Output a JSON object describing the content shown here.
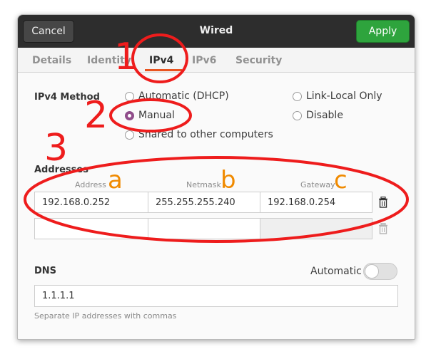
{
  "window": {
    "title": "Wired",
    "cancel_label": "Cancel",
    "apply_label": "Apply"
  },
  "tabs": [
    {
      "label": "Details",
      "active": false
    },
    {
      "label": "Identity",
      "active": false
    },
    {
      "label": "IPv4",
      "active": true
    },
    {
      "label": "IPv6",
      "active": false
    },
    {
      "label": "Security",
      "active": false
    }
  ],
  "ipv4": {
    "method_label": "IPv4 Method",
    "methods": [
      {
        "label": "Automatic (DHCP)",
        "selected": false
      },
      {
        "label": "Manual",
        "selected": true
      },
      {
        "label": "Shared to other computers",
        "selected": false
      },
      {
        "label": "Link-Local Only",
        "selected": false
      },
      {
        "label": "Disable",
        "selected": false
      }
    ],
    "addresses_label": "Addresses",
    "columns": {
      "address": "Address",
      "netmask": "Netmask",
      "gateway": "Gateway"
    },
    "rows": [
      {
        "address": "192.168.0.252",
        "netmask": "255.255.255.240",
        "gateway": "192.168.0.254"
      },
      {
        "address": "",
        "netmask": "",
        "gateway": ""
      }
    ]
  },
  "dns": {
    "label": "DNS",
    "automatic_label": "Automatic",
    "automatic_on": false,
    "value": "1.1.1.1",
    "hint": "Separate IP addresses with commas"
  },
  "annotations": {
    "numbers": [
      "1",
      "2",
      "3"
    ],
    "letters": [
      "a",
      "b",
      "c"
    ]
  },
  "colors": {
    "accent": "#e95420",
    "apply_green": "#2ea43d",
    "radio_selected": "#924d8b",
    "annotation_red": "#ee1c1c",
    "annotation_orange": "#f08a00"
  }
}
